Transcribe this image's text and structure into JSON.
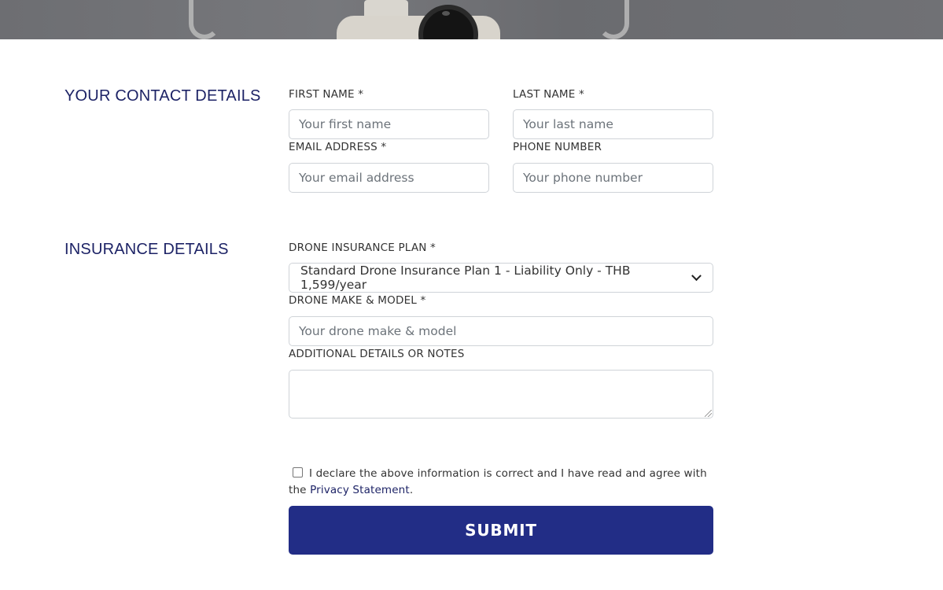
{
  "sections": {
    "contact_title": "YOUR CONTACT DETAILS",
    "insurance_title": "INSURANCE DETAILS"
  },
  "fields": {
    "first_name": {
      "label": "FIRST NAME *",
      "placeholder": "Your first name",
      "value": ""
    },
    "last_name": {
      "label": "LAST NAME *",
      "placeholder": "Your last name",
      "value": ""
    },
    "email": {
      "label": "EMAIL ADDRESS *",
      "placeholder": "Your email address",
      "value": ""
    },
    "phone": {
      "label": "PHONE NUMBER",
      "placeholder": "Your phone number",
      "value": ""
    },
    "plan": {
      "label": "DRONE INSURANCE PLAN *",
      "selected": "Standard Drone Insurance Plan 1 - Liability Only - THB 1,599/year"
    },
    "drone_model": {
      "label": "DRONE MAKE & MODEL *",
      "placeholder": "Your drone make & model",
      "value": ""
    },
    "notes": {
      "label": "ADDITIONAL DETAILS OR NOTES",
      "value": ""
    }
  },
  "declaration": {
    "text": "I declare the above information is correct and I have read and agree with the",
    "link": "Privacy Statement",
    "suffix": ".",
    "checked": false
  },
  "submit": {
    "label": "SUBMIT"
  },
  "colors": {
    "heading": "#1d2366",
    "button": "#222d86",
    "border": "#cfd3d8"
  },
  "icons": {
    "select_arrow": "chevron-down-icon"
  }
}
